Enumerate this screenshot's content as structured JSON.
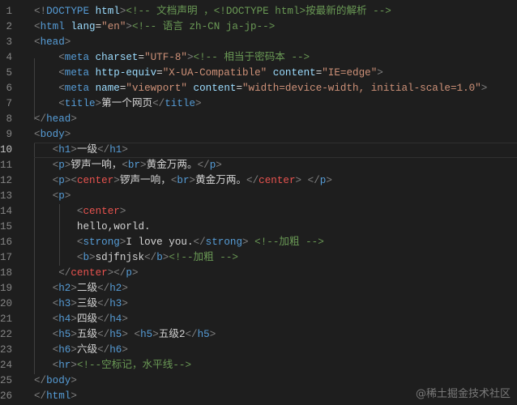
{
  "editor": {
    "current_line": 10,
    "lines": [
      {
        "num": "1",
        "tokens": [
          [
            "p",
            "<!"
          ],
          [
            "t",
            "DOCTYPE"
          ],
          [
            "a",
            " html"
          ],
          [
            "p",
            ">"
          ],
          [
            "c",
            "<!-- 文档声明 ，<!DOCTYPE html>按最新的解析 -->"
          ]
        ]
      },
      {
        "num": "2",
        "tokens": [
          [
            "p",
            "<"
          ],
          [
            "t",
            "html"
          ],
          [
            "a",
            " lang"
          ],
          [
            "x",
            "="
          ],
          [
            "s",
            "\"en\""
          ],
          [
            "p",
            ">"
          ],
          [
            "c",
            "<!-- 语言 zh-CN ja-jp-->"
          ]
        ]
      },
      {
        "num": "3",
        "tokens": [
          [
            "p",
            "<"
          ],
          [
            "t",
            "head"
          ],
          [
            "p",
            ">"
          ]
        ]
      },
      {
        "num": "4",
        "tokens": [
          [
            "x",
            "    "
          ],
          [
            "p",
            "<"
          ],
          [
            "t",
            "meta"
          ],
          [
            "a",
            " charset"
          ],
          [
            "x",
            "="
          ],
          [
            "s",
            "\"UTF-8\""
          ],
          [
            "p",
            ">"
          ],
          [
            "c",
            "<!-- 相当于密码本 -->"
          ]
        ]
      },
      {
        "num": "5",
        "tokens": [
          [
            "x",
            "    "
          ],
          [
            "p",
            "<"
          ],
          [
            "t",
            "meta"
          ],
          [
            "a",
            " http-equiv"
          ],
          [
            "x",
            "="
          ],
          [
            "s",
            "\"X-UA-Compatible\""
          ],
          [
            "a",
            " content"
          ],
          [
            "x",
            "="
          ],
          [
            "s",
            "\"IE=edge\""
          ],
          [
            "p",
            ">"
          ]
        ]
      },
      {
        "num": "6",
        "tokens": [
          [
            "x",
            "    "
          ],
          [
            "p",
            "<"
          ],
          [
            "t",
            "meta"
          ],
          [
            "a",
            " name"
          ],
          [
            "x",
            "="
          ],
          [
            "s",
            "\"viewport\""
          ],
          [
            "a",
            " content"
          ],
          [
            "x",
            "="
          ],
          [
            "s",
            "\"width=device-width, initial-scale=1.0\""
          ],
          [
            "p",
            ">"
          ]
        ]
      },
      {
        "num": "7",
        "tokens": [
          [
            "x",
            "    "
          ],
          [
            "p",
            "<"
          ],
          [
            "t",
            "title"
          ],
          [
            "p",
            ">"
          ],
          [
            "x",
            "第一个网页"
          ],
          [
            "p",
            "</"
          ],
          [
            "t",
            "title"
          ],
          [
            "p",
            ">"
          ]
        ]
      },
      {
        "num": "8",
        "tokens": [
          [
            "p",
            "</"
          ],
          [
            "t",
            "head"
          ],
          [
            "p",
            ">"
          ]
        ]
      },
      {
        "num": "9",
        "tokens": [
          [
            "p",
            "<"
          ],
          [
            "t",
            "body"
          ],
          [
            "p",
            ">"
          ]
        ]
      },
      {
        "num": "10",
        "tokens": [
          [
            "x",
            "   "
          ],
          [
            "p",
            "<"
          ],
          [
            "t",
            "h1"
          ],
          [
            "p",
            ">"
          ],
          [
            "x",
            "一级"
          ],
          [
            "p",
            "</"
          ],
          [
            "t",
            "h1"
          ],
          [
            "p",
            ">"
          ]
        ]
      },
      {
        "num": "11",
        "tokens": [
          [
            "x",
            "   "
          ],
          [
            "p",
            "<"
          ],
          [
            "t",
            "p"
          ],
          [
            "p",
            ">"
          ],
          [
            "x",
            "锣声一响，"
          ],
          [
            "p",
            "<"
          ],
          [
            "t",
            "br"
          ],
          [
            "p",
            ">"
          ],
          [
            "x",
            "黄金万两。"
          ],
          [
            "p",
            "</"
          ],
          [
            "t",
            "p"
          ],
          [
            "p",
            ">"
          ]
        ]
      },
      {
        "num": "12",
        "tokens": [
          [
            "x",
            "   "
          ],
          [
            "p",
            "<"
          ],
          [
            "t",
            "p"
          ],
          [
            "p",
            "><"
          ],
          [
            "r",
            "center"
          ],
          [
            "p",
            ">"
          ],
          [
            "x",
            "锣声一响，"
          ],
          [
            "p",
            "<"
          ],
          [
            "t",
            "br"
          ],
          [
            "p",
            ">"
          ],
          [
            "x",
            "黄金万两。"
          ],
          [
            "p",
            "</"
          ],
          [
            "r",
            "center"
          ],
          [
            "p",
            ">"
          ],
          [
            "x",
            " "
          ],
          [
            "p",
            "</"
          ],
          [
            "t",
            "p"
          ],
          [
            "p",
            ">"
          ]
        ]
      },
      {
        "num": "13",
        "tokens": [
          [
            "x",
            "   "
          ],
          [
            "p",
            "<"
          ],
          [
            "t",
            "p"
          ],
          [
            "p",
            ">"
          ]
        ]
      },
      {
        "num": "14",
        "tokens": [
          [
            "x",
            "       "
          ],
          [
            "p",
            "<"
          ],
          [
            "r",
            "center"
          ],
          [
            "p",
            ">"
          ]
        ]
      },
      {
        "num": "15",
        "tokens": [
          [
            "x",
            "       hello,world."
          ]
        ]
      },
      {
        "num": "16",
        "tokens": [
          [
            "x",
            "       "
          ],
          [
            "p",
            "<"
          ],
          [
            "t",
            "strong"
          ],
          [
            "p",
            ">"
          ],
          [
            "x",
            "I love you."
          ],
          [
            "p",
            "</"
          ],
          [
            "t",
            "strong"
          ],
          [
            "p",
            ">"
          ],
          [
            "x",
            " "
          ],
          [
            "c",
            "<!--加粗 -->"
          ]
        ]
      },
      {
        "num": "17",
        "tokens": [
          [
            "x",
            "       "
          ],
          [
            "p",
            "<"
          ],
          [
            "t",
            "b"
          ],
          [
            "p",
            ">"
          ],
          [
            "x",
            "sdjfnjsk"
          ],
          [
            "p",
            "</"
          ],
          [
            "t",
            "b"
          ],
          [
            "p",
            ">"
          ],
          [
            "c",
            "<!--加粗 -->"
          ]
        ]
      },
      {
        "num": "18",
        "tokens": [
          [
            "x",
            "    "
          ],
          [
            "p",
            "</"
          ],
          [
            "r",
            "center"
          ],
          [
            "p",
            "></"
          ],
          [
            "t",
            "p"
          ],
          [
            "p",
            ">"
          ]
        ]
      },
      {
        "num": "19",
        "tokens": [
          [
            "x",
            "   "
          ],
          [
            "p",
            "<"
          ],
          [
            "t",
            "h2"
          ],
          [
            "p",
            ">"
          ],
          [
            "x",
            "二级"
          ],
          [
            "p",
            "</"
          ],
          [
            "t",
            "h2"
          ],
          [
            "p",
            ">"
          ]
        ]
      },
      {
        "num": "20",
        "tokens": [
          [
            "x",
            "   "
          ],
          [
            "p",
            "<"
          ],
          [
            "t",
            "h3"
          ],
          [
            "p",
            ">"
          ],
          [
            "x",
            "三级"
          ],
          [
            "p",
            "</"
          ],
          [
            "t",
            "h3"
          ],
          [
            "p",
            ">"
          ]
        ]
      },
      {
        "num": "21",
        "tokens": [
          [
            "x",
            "   "
          ],
          [
            "p",
            "<"
          ],
          [
            "t",
            "h4"
          ],
          [
            "p",
            ">"
          ],
          [
            "x",
            "四级"
          ],
          [
            "p",
            "</"
          ],
          [
            "t",
            "h4"
          ],
          [
            "p",
            ">"
          ]
        ]
      },
      {
        "num": "22",
        "tokens": [
          [
            "x",
            "   "
          ],
          [
            "p",
            "<"
          ],
          [
            "t",
            "h5"
          ],
          [
            "p",
            ">"
          ],
          [
            "x",
            "五级"
          ],
          [
            "p",
            "</"
          ],
          [
            "t",
            "h5"
          ],
          [
            "p",
            ">"
          ],
          [
            "x",
            " "
          ],
          [
            "p",
            "<"
          ],
          [
            "t",
            "h5"
          ],
          [
            "p",
            ">"
          ],
          [
            "x",
            "五级2"
          ],
          [
            "p",
            "</"
          ],
          [
            "t",
            "h5"
          ],
          [
            "p",
            ">"
          ]
        ]
      },
      {
        "num": "23",
        "tokens": [
          [
            "x",
            "   "
          ],
          [
            "p",
            "<"
          ],
          [
            "t",
            "h6"
          ],
          [
            "p",
            ">"
          ],
          [
            "x",
            "六级"
          ],
          [
            "p",
            "</"
          ],
          [
            "t",
            "h6"
          ],
          [
            "p",
            ">"
          ]
        ]
      },
      {
        "num": "24",
        "tokens": [
          [
            "x",
            "   "
          ],
          [
            "p",
            "<"
          ],
          [
            "t",
            "hr"
          ],
          [
            "p",
            ">"
          ],
          [
            "c",
            "<!--空标记，水平线-->"
          ]
        ]
      },
      {
        "num": "25",
        "tokens": [
          [
            "p",
            "</"
          ],
          [
            "t",
            "body"
          ],
          [
            "p",
            ">"
          ]
        ]
      },
      {
        "num": "26",
        "tokens": [
          [
            "p",
            "</"
          ],
          [
            "t",
            "html"
          ],
          [
            "p",
            ">"
          ]
        ]
      }
    ]
  },
  "watermark": "@稀土掘金技术社区"
}
